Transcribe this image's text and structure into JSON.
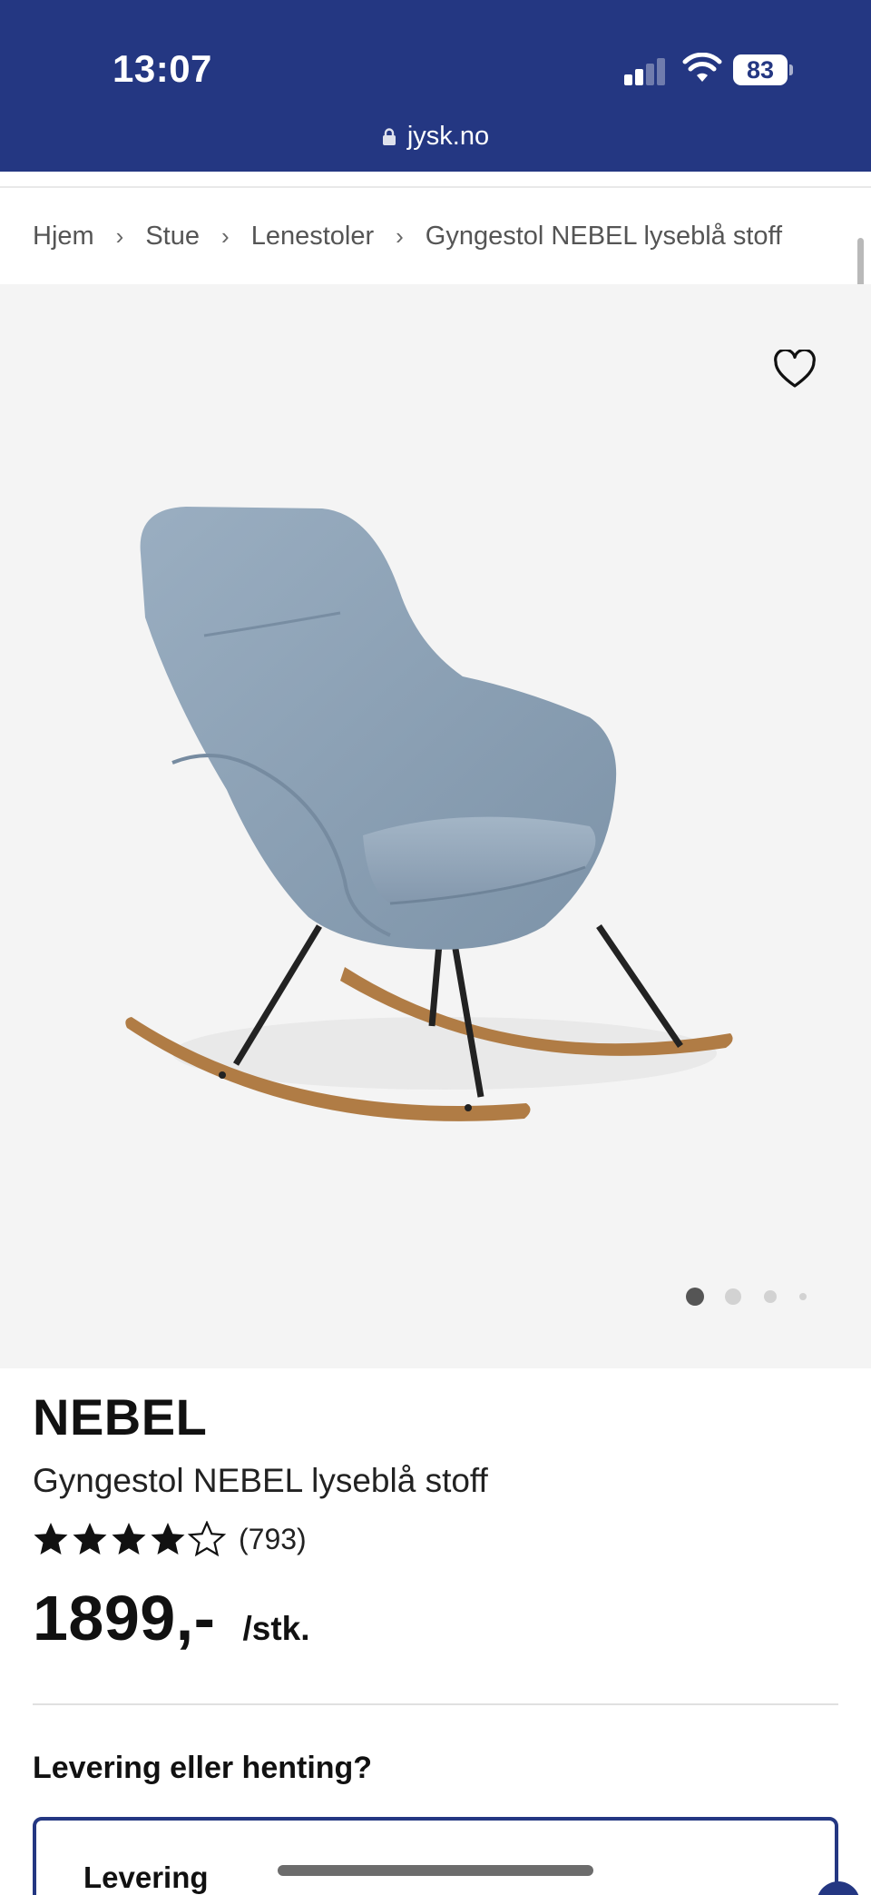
{
  "status_bar": {
    "time": "13:07",
    "battery": "83"
  },
  "browser": {
    "url": "jysk.no"
  },
  "breadcrumb": [
    {
      "label": "Hjem"
    },
    {
      "label": "Stue"
    },
    {
      "label": "Lenestoler"
    },
    {
      "label": "Gyngestol NEBEL lyseblå stoff"
    }
  ],
  "breadcrumb_separator": "›",
  "gallery": {
    "image_count": 4,
    "active_index": 0
  },
  "product": {
    "brand": "NEBEL",
    "name": "Gyngestol NEBEL lyseblå stoff",
    "rating": 4.5,
    "rating_max": 5,
    "review_count": "(793)",
    "price": "1899,-",
    "unit": "/stk."
  },
  "delivery": {
    "question": "Levering eller henting?",
    "option_label": "Levering"
  },
  "colors": {
    "brand_blue": "#243782",
    "gallery_background": "#f4f4f4",
    "chair_fabric": "#8fa4b8",
    "chair_rocker_wood": "#b07c45"
  },
  "icons": {
    "wishlist": "heart-outline-icon",
    "secure": "lock-icon",
    "network": "cellular-signal-icon",
    "wifi": "wifi-icon",
    "breadcrumb_separator": "chevron-right-icon",
    "rating": "star-icon"
  }
}
